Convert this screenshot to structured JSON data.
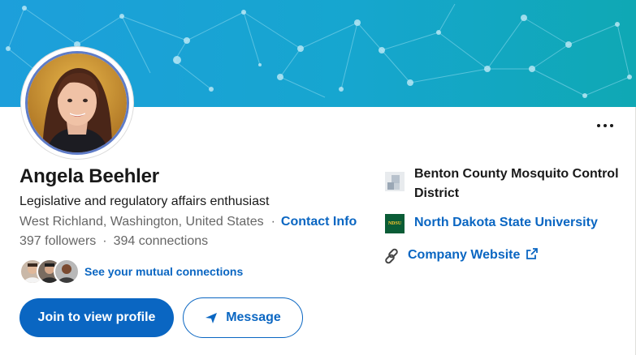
{
  "profile": {
    "name": "Angela Beehler",
    "headline": "Legislative and regulatory affairs enthusiast",
    "location": "West Richland, Washington, United States",
    "separator": "·",
    "contact_info_label": "Contact Info",
    "followers": "397 followers",
    "connections": "394 connections",
    "mutual_connections_label": "See your mutual connections"
  },
  "actions": {
    "join_label": "Join to view profile",
    "message_label": "Message",
    "more_icon": "more-horizontal-icon"
  },
  "organizations": [
    {
      "name": "Benton County Mosquito Control District",
      "icon": "company-logo"
    },
    {
      "name": "North Dakota State University",
      "icon": "school-logo",
      "logo_text": "NDSU"
    },
    {
      "name": "Company Website",
      "icon": "link-icon",
      "trailing_icon": "external-link-icon"
    }
  ],
  "colors": {
    "accent": "#0a66c2",
    "banner_start": "#1ea5dc",
    "banner_end": "#10a8b8",
    "muted_text": "#666666",
    "avatar_ring": "#5f7cc7"
  }
}
